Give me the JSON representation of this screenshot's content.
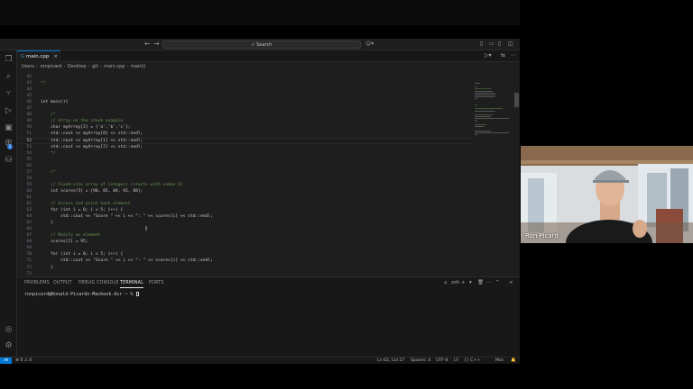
{
  "titlebar": {
    "search_label": "Search"
  },
  "tabs": [
    {
      "label": "main.cpp"
    }
  ],
  "breadcrumb": [
    "Users",
    "ronpicard",
    "Desktop",
    "git",
    "main.cpp",
    "main()"
  ],
  "editor": {
    "current_line": 52,
    "lines": [
      {
        "n": "42",
        "text": "",
        "kind": ""
      },
      {
        "n": "43",
        "text": "*/",
        "kind": "cm"
      },
      {
        "n": "44",
        "text": "",
        "kind": ""
      },
      {
        "n": "45",
        "text": "",
        "kind": ""
      },
      {
        "n": "46",
        "text": "int main(){",
        "kind": ""
      },
      {
        "n": "47",
        "text": "",
        "kind": ""
      },
      {
        "n": "48",
        "text": "    /*",
        "kind": "cm"
      },
      {
        "n": "49",
        "text": "    // Array on the stack example",
        "kind": "cm"
      },
      {
        "n": "50",
        "text": "    char myArray[3] = {'a','b','c'};",
        "kind": ""
      },
      {
        "n": "51",
        "text": "    std::cout << myArray[0] << std::endl;",
        "kind": ""
      },
      {
        "n": "52",
        "text": "    std::cout << myArray[1] << std::endl;",
        "kind": ""
      },
      {
        "n": "53",
        "text": "    std::cout << myArray[2] << std::endl;",
        "kind": ""
      },
      {
        "n": "54",
        "text": "    */",
        "kind": "cm"
      },
      {
        "n": "55",
        "text": "",
        "kind": ""
      },
      {
        "n": "56",
        "text": "",
        "kind": ""
      },
      {
        "n": "57",
        "text": "    /*",
        "kind": "cm"
      },
      {
        "n": "58",
        "text": "",
        "kind": ""
      },
      {
        "n": "59",
        "text": "    // Fixed-size array of integers (starts with index 0)",
        "kind": "cm"
      },
      {
        "n": "60",
        "text": "    int scores[5] = {90, 85, 84, 92, 88};",
        "kind": ""
      },
      {
        "n": "61",
        "text": "",
        "kind": ""
      },
      {
        "n": "62",
        "text": "    // Access and print each element",
        "kind": "cm"
      },
      {
        "n": "63",
        "text": "    for (int i = 0; i < 5; i++) {",
        "kind": ""
      },
      {
        "n": "64",
        "text": "        std::cout << \"Score \" << i << \": \" << scores[i] << std::endl;",
        "kind": ""
      },
      {
        "n": "65",
        "text": "    }",
        "kind": ""
      },
      {
        "n": "66",
        "text": "",
        "kind": ""
      },
      {
        "n": "67",
        "text": "    // Modify an element",
        "kind": "cm"
      },
      {
        "n": "68",
        "text": "    scores[2] = 95;",
        "kind": ""
      },
      {
        "n": "69",
        "text": "",
        "kind": ""
      },
      {
        "n": "70",
        "text": "    for (int i = 0; i < 5; i++) {",
        "kind": ""
      },
      {
        "n": "71",
        "text": "        std::cout << \"Score \" << i << \": \" << scores[i] << std::endl;",
        "kind": ""
      },
      {
        "n": "72",
        "text": "    }",
        "kind": ""
      },
      {
        "n": "73",
        "text": "",
        "kind": ""
      }
    ]
  },
  "panel": {
    "tabs": [
      "PROBLEMS",
      "OUTPUT",
      "DEBUG CONSOLE",
      "TERMINAL",
      "PORTS"
    ],
    "active_tab": "TERMINAL",
    "terminal_shell": "zsh",
    "terminal_prompt": "ronpicard@Ronald-Picards-Macbook-Air ~ % "
  },
  "statusbar": {
    "errors": "0",
    "warnings": "0",
    "position": "Ln 62, Col 27",
    "spaces": "Spaces: 4",
    "encoding": "UTF-8",
    "eol": "LF",
    "language": "{} C++",
    "platform": "Mac"
  },
  "webcam": {
    "participant_name": "Ron Picard"
  },
  "colors": {
    "editor_bg": "#1e1e1e",
    "comment": "#6a9955",
    "accent": "#0078d4",
    "remote_badge": "#0078d4"
  }
}
